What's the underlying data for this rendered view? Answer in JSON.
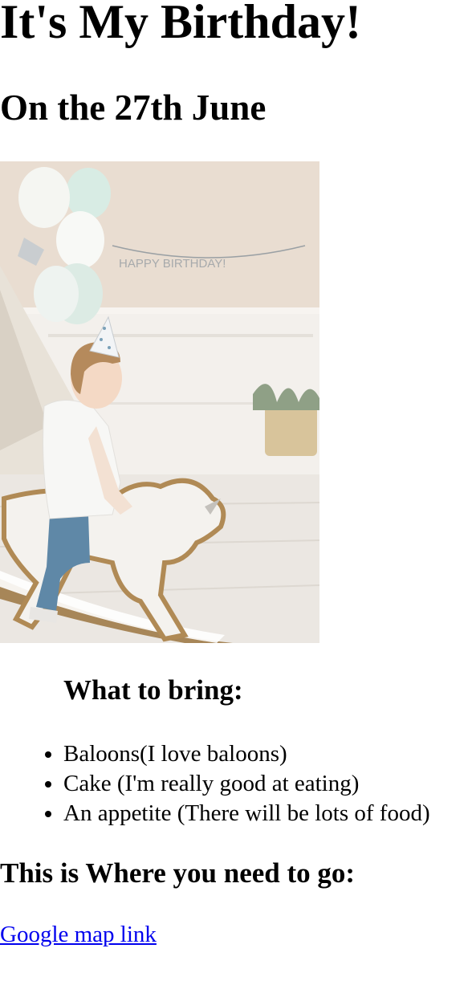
{
  "header": {
    "title": "It's My Birthday!",
    "date": "On the 27th June"
  },
  "photo": {
    "banner_text": "HAPPY BIRTHDAY!"
  },
  "bring": {
    "heading": "What to bring:",
    "items": [
      "Baloons(I love baloons)",
      "Cake (I'm really good at eating)",
      "An appetite (There will be lots of food)"
    ]
  },
  "directions": {
    "heading": "This is Where you need to go:",
    "link_label": "Google map link"
  },
  "colors": {
    "link": "#0000ee",
    "text": "#000000",
    "background": "#ffffff"
  }
}
